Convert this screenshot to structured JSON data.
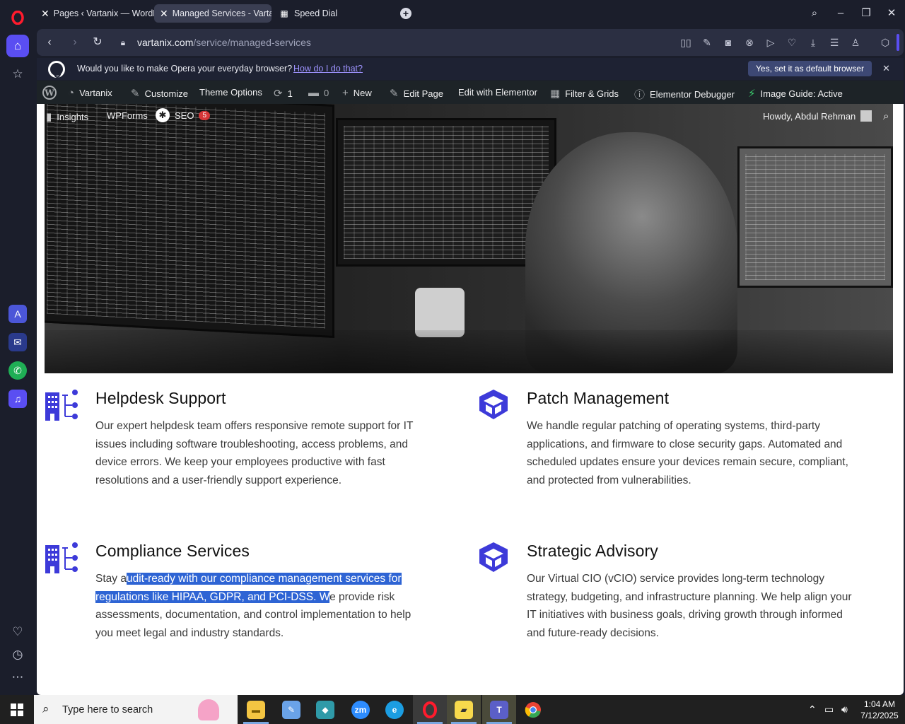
{
  "browser": {
    "tabs": [
      {
        "title": "Pages ‹ Vartanix — WordP",
        "icon": "vartanix-x-icon",
        "active": false
      },
      {
        "title": "Managed Services - Vartan",
        "icon": "vartanix-x-icon",
        "active": true
      },
      {
        "title": "Speed Dial",
        "icon": "speed-dial-icon",
        "active": false
      }
    ],
    "url_domain": "vartanix.com",
    "url_path": "/service/managed-services",
    "infobar": {
      "message": "Would you like to make Opera your everyday browser?",
      "link": "How do I do that?",
      "cta": "Yes, set it as default browser"
    }
  },
  "wpbar": {
    "site": "Vartanix",
    "customize": "Customize",
    "theme_options": "Theme Options",
    "updates": "1",
    "comments": "0",
    "new": "New",
    "edit_page": "Edit Page",
    "edit_elementor": "Edit with Elementor",
    "filter_grids": "Filter & Grids",
    "elementor_debugger": "Elementor Debugger",
    "image_guide": "Image Guide: Active",
    "insights": "Insights",
    "wpforms": "WPForms",
    "seo": "SEO",
    "seo_badge": "5",
    "howdy": "Howdy, Abdul Rehman"
  },
  "services": [
    {
      "title": "Helpdesk Support",
      "icon": "org-chart-icon",
      "text": "Our expert helpdesk team offers responsive remote support for IT issues including software troubleshooting, access problems, and device errors. We keep your employees productive with fast resolutions and a user-friendly support experience."
    },
    {
      "title": "Patch Management",
      "icon": "package-box-icon",
      "text": "We handle regular patching of operating systems, third-party applications, and firmware to close security gaps. Automated and scheduled updates ensure your devices remain secure, compliant, and protected from vulnerabilities."
    },
    {
      "title": "Compliance Services",
      "icon": "org-chart-icon",
      "text_pre": "Stay a",
      "text_selected": "udit-ready with our compliance management services for regulations like HIPAA, GDPR, and PCI-DSS. W",
      "text_post": "e provide risk assessments, documentation, and control implementation to help you meet legal and industry standards."
    },
    {
      "title": "Strategic Advisory",
      "icon": "package-box-icon",
      "text": "Our Virtual CIO (vCIO) service provides long-term technology strategy, budgeting, and infrastructure planning. We help align your IT initiatives with business goals, driving growth through informed and future-ready decisions."
    }
  ],
  "taskbar": {
    "search_placeholder": "Type here to search",
    "time": "1:04 AM",
    "date": "7/12/2025",
    "apps": [
      "file-explorer",
      "paint",
      "app-blue",
      "zoom",
      "edge",
      "opera",
      "sticky-notes",
      "teams",
      "chrome"
    ]
  },
  "colors": {
    "accent": "#3d3ad9",
    "selection": "#2e64d4",
    "opera_red": "#ff1b2d",
    "rail_active": "#5a4ef2"
  }
}
